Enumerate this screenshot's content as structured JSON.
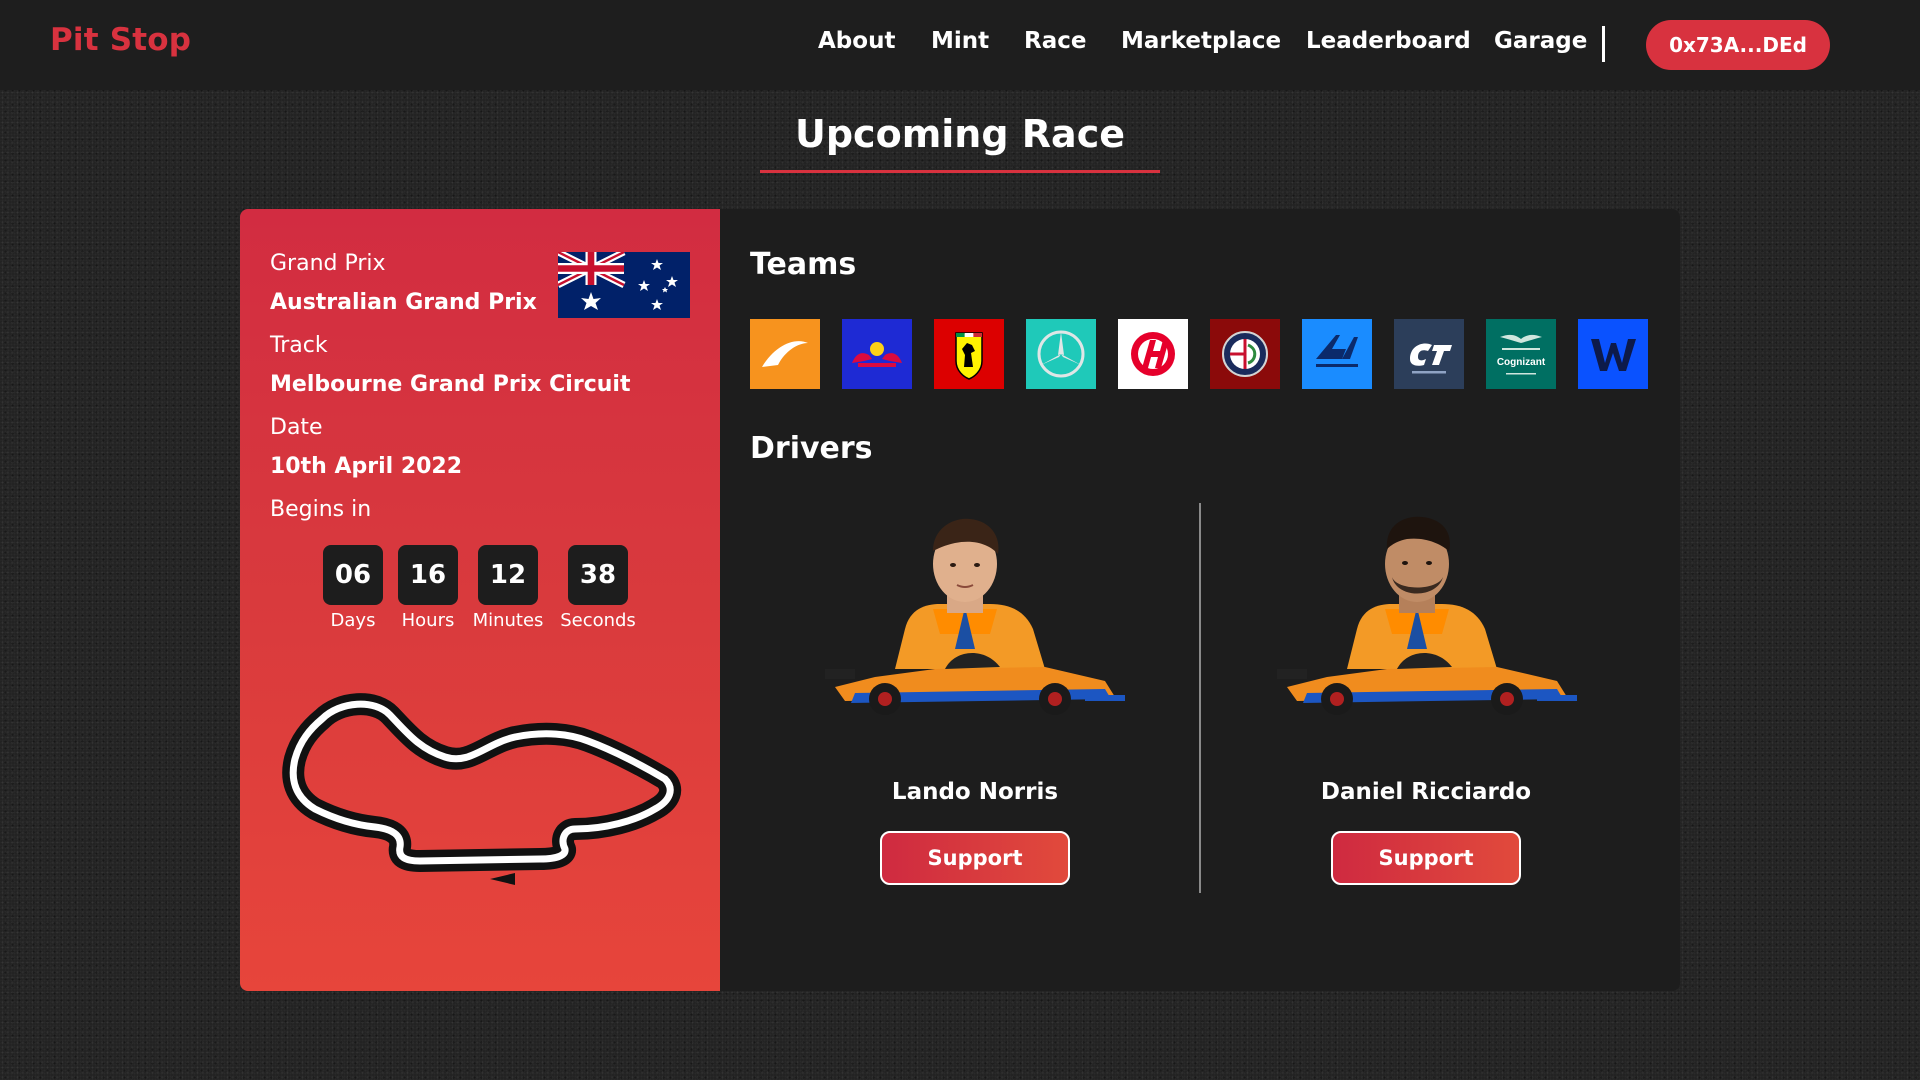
{
  "app": {
    "brand": "Pit Stop",
    "nav": [
      "About",
      "Mint",
      "Race",
      "Marketplace",
      "Leaderboard",
      "Garage"
    ],
    "wallet": "0x73A...DEd",
    "brand_color": "#d8323f"
  },
  "race": {
    "heading": "Upcoming Race",
    "grand_prix_label": "Grand Prix",
    "grand_prix": "Australian Grand Prix",
    "track_label": "Track",
    "track": "Melbourne Grand Prix Circuit",
    "date_label": "Date",
    "date": "10th April 2022",
    "begins_label": "Begins in",
    "flag_icon": "australia-flag-icon",
    "countdown": [
      {
        "value": "06",
        "unit": "Days"
      },
      {
        "value": "16",
        "unit": "Hours"
      },
      {
        "value": "12",
        "unit": "Minutes"
      },
      {
        "value": "38",
        "unit": "Seconds"
      }
    ]
  },
  "teams": {
    "title": "Teams",
    "logos": [
      {
        "icon": "mclaren-logo-icon",
        "color": "#f7931e"
      },
      {
        "icon": "red-bull-logo-icon",
        "color": "#1e2ad4"
      },
      {
        "icon": "ferrari-logo-icon",
        "color": "#dc0000"
      },
      {
        "icon": "mercedes-logo-icon",
        "color": "#1fc9b9"
      },
      {
        "icon": "haas-logo-icon",
        "color": "#ffffff"
      },
      {
        "icon": "alfa-romeo-logo-icon",
        "color": "#8b0a0a"
      },
      {
        "icon": "alpine-logo-icon",
        "color": "#1a8cff"
      },
      {
        "icon": "alphatauri-logo-icon",
        "color": "#2c3e5a"
      },
      {
        "icon": "aston-martin-logo-icon",
        "color": "#006f62",
        "text": "Cognizant"
      },
      {
        "icon": "williams-logo-icon",
        "color": "#0a52ff"
      }
    ]
  },
  "drivers": {
    "title": "Drivers",
    "list": [
      {
        "name": "Lando Norris",
        "action": "Support"
      },
      {
        "name": "Daniel Ricciardo",
        "action": "Support"
      }
    ]
  }
}
